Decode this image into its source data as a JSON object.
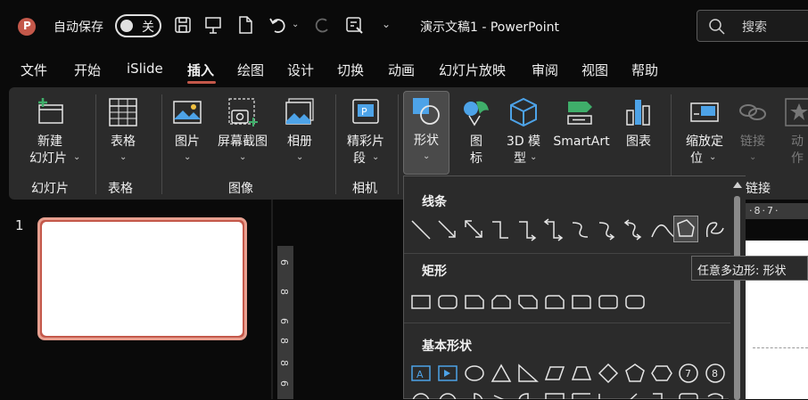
{
  "titlebar": {
    "autosave_label": "自动保存",
    "autosave_state": "关",
    "document_title": "演示文稿1 - PowerPoint",
    "search_label": "搜索"
  },
  "menu": [
    "文件",
    "开始",
    "iSlide",
    "插入",
    "绘图",
    "设计",
    "切换",
    "动画",
    "幻灯片放映",
    "审阅",
    "视图",
    "帮助"
  ],
  "ribbon": {
    "new_slide_line1": "新建",
    "new_slide_line2": "幻灯片",
    "table": "表格",
    "picture": "图片",
    "screenshot": "屏幕截图",
    "album": "相册",
    "highlight_line1": "精彩片",
    "highlight_line2": "段",
    "shapes": "形状",
    "icons_line1": "图",
    "icons_line2": "标",
    "model_line1": "3D 模",
    "model_line2": "型",
    "smartart": "SmartArt",
    "chart": "图表",
    "zoom_line1": "缩放定",
    "zoom_line2": "位",
    "link": "链接",
    "action": "动作",
    "groups": {
      "slides": "幻灯片",
      "tables": "表格",
      "images": "图像",
      "camera": "相机",
      "links": "链接"
    }
  },
  "slide_panel": {
    "slide_number": "1"
  },
  "ruler_marks": [
    "6",
    "8",
    "6",
    "8",
    "8",
    "6"
  ],
  "top_ruler": "·8·7·",
  "gallery": {
    "sections": [
      "线条",
      "矩形",
      "基本形状"
    ]
  },
  "tooltip": "任意多边形: 形状",
  "colors": {
    "accent": "#c4584a",
    "selection": "#4a4a4a",
    "ribbon_bg": "#2b2b2b",
    "shape_blue": "#4da3e8"
  }
}
